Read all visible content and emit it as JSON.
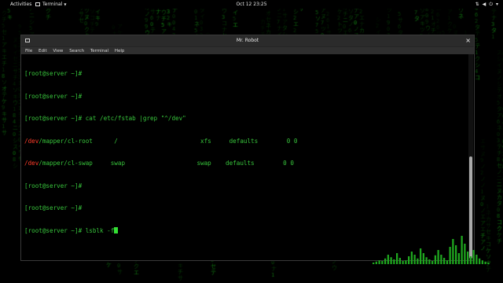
{
  "topbar": {
    "activities": "Activities",
    "app_menu": "Terminal",
    "clock": "Oct 12  23:25",
    "icons": [
      "network-icon",
      "volume-icon",
      "power-icon",
      "chevron-down-icon"
    ]
  },
  "window": {
    "title": "Mr. Robot",
    "close_glyph": "×",
    "menu": [
      "File",
      "Edit",
      "View",
      "Search",
      "Terminal",
      "Help"
    ]
  },
  "terminal": {
    "lines": [
      {
        "text": "[root@server ~]#"
      },
      {
        "text": "[root@server ~]#"
      },
      {
        "text": "[root@server ~]# cat /etc/fstab |grep \"^/dev\""
      },
      {
        "dev": "/dev",
        "rest": "/mapper/cl-root      /                       xfs     defaults        0 0"
      },
      {
        "dev": "/dev",
        "rest": "/mapper/cl-swap     swap                    swap    defaults        0 0"
      },
      {
        "text": "[root@server ~]#"
      },
      {
        "text": "[root@server ~]#"
      },
      {
        "text": "[root@server ~]# lsblk -f"
      }
    ]
  },
  "colors": {
    "prompt_green": "#37c43b",
    "dev_red": "#ff3d2a",
    "cursor_green": "#34e034",
    "rain_green": "#1fa81f"
  },
  "visualizer": {
    "levels": [
      0.05,
      0.08,
      0.12,
      0.1,
      0.18,
      0.3,
      0.22,
      0.15,
      0.35,
      0.2,
      0.1,
      0.12,
      0.25,
      0.4,
      0.3,
      0.18,
      0.5,
      0.35,
      0.22,
      0.15,
      0.1,
      0.28,
      0.45,
      0.3,
      0.2,
      0.12,
      0.55,
      0.8,
      0.6,
      0.35,
      0.9,
      0.65,
      0.4,
      0.25,
      0.45,
      0.3,
      0.18,
      0.12,
      0.08,
      0.05
    ]
  }
}
